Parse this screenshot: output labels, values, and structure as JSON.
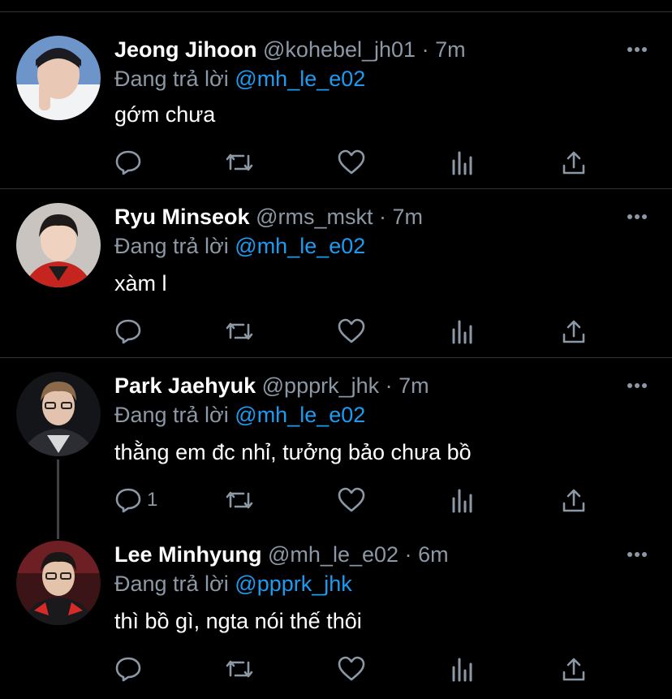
{
  "colors": {
    "background": "#000000",
    "text": "#ffffff",
    "muted": "#8b98a5",
    "link": "#1d9bf0",
    "divider": "#2f3336"
  },
  "tweets": [
    {
      "name": "Jeong Jihoon",
      "handle": "@kohebel_jh01",
      "dot": "·",
      "time": "7m",
      "reply_prefix": "Đang trả lời",
      "reply_to": "@mh_le_e02",
      "text": "gớm chưa",
      "reply_count": ""
    },
    {
      "name": "Ryu Minseok",
      "handle": "@rms_mskt",
      "dot": "·",
      "time": "7m",
      "reply_prefix": "Đang trả lời",
      "reply_to": "@mh_le_e02",
      "text": "xàm l",
      "reply_count": ""
    },
    {
      "name": "Park Jaehyuk",
      "handle": "@ppprk_jhk",
      "dot": "·",
      "time": "7m",
      "reply_prefix": "Đang trả lời",
      "reply_to": "@mh_le_e02",
      "text": "thằng em đc nhỉ, tưởng bảo chưa bồ",
      "reply_count": "1"
    },
    {
      "name": "Lee Minhyung",
      "handle": "@mh_le_e02",
      "dot": "·",
      "time": "6m",
      "reply_prefix": "Đang trả lời",
      "reply_to": "@ppprk_jhk",
      "text": "thì bồ gì, ngta nói thế thôi",
      "reply_count": ""
    }
  ],
  "icons": {
    "more": "more-horizontal-icon",
    "reply": "reply-bubble-icon",
    "retweet": "retweet-icon",
    "like": "heart-icon",
    "views": "analytics-icon",
    "share": "share-icon"
  }
}
